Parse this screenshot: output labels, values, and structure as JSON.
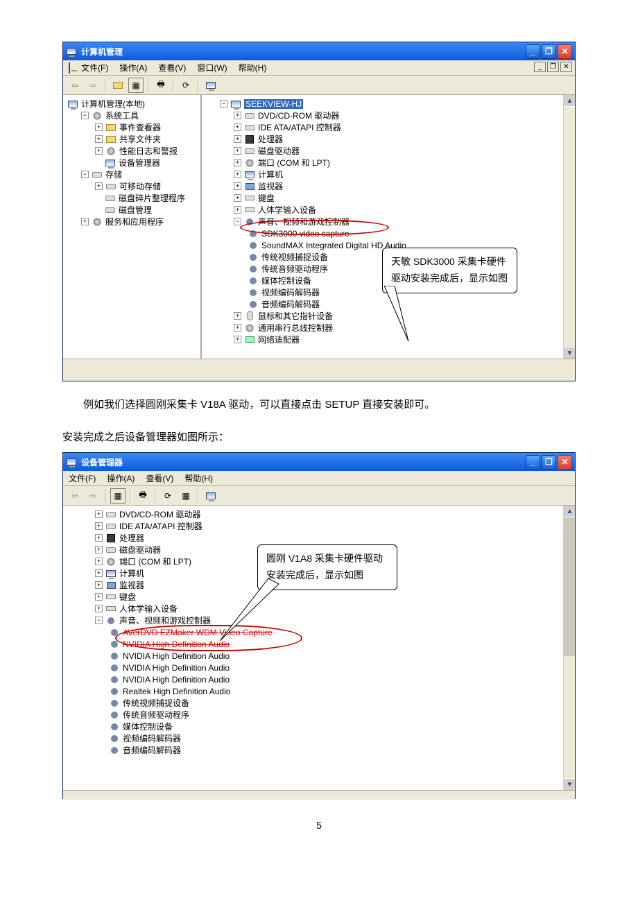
{
  "page_number": "5",
  "body_text_1": "例如我们选择圆刚采集卡 V18A 驱动，可以直接点击 SETUP 直接安装即可。",
  "body_text_2": "安装完成之后设备管理器如图所示：",
  "win1": {
    "title": "计算机管理",
    "menu": {
      "file": "文件(F)",
      "action": "操作(A)",
      "view": "查看(V)",
      "window": "窗口(W)",
      "help": "帮助(H)"
    },
    "left_tree": {
      "root": "计算机管理(本地)",
      "sys_tools": "系统工具",
      "event_viewer": "事件查看器",
      "shared_folders": "共享文件夹",
      "perf": "性能日志和警报",
      "dev_mgr": "设备管理器",
      "storage": "存储",
      "removable": "可移动存储",
      "defrag": "磁盘碎片整理程序",
      "disk_mgmt": "磁盘管理",
      "services": "服务和应用程序"
    },
    "right_tree": {
      "root": "SEEKVIEW-HJ",
      "dvd": "DVD/CD-ROM 驱动器",
      "ide": "IDE ATA/ATAPI 控制器",
      "cpu": "处理器",
      "disk_drive": "磁盘驱动器",
      "ports": "端口 (COM 和 LPT)",
      "computer": "计算机",
      "monitor": "监视器",
      "keyboard": "键盘",
      "hid": "人体学输入设备",
      "sound": "声音、视频和游戏控制器",
      "sdk3000": "SDK3000 video capture",
      "soundmax": "SoundMAX Integrated Digital HD Audio",
      "legacy_vid": "传统视频捕捉设备",
      "legacy_aud": "传统音频驱动程序",
      "media_ctrl": "媒体控制设备",
      "vid_codec": "视频编码解码器",
      "aud_codec": "音频编码解码器",
      "mouse": "鼠标和其它指针设备",
      "usb": "通用串行总线控制器",
      "network": "网络适配器"
    },
    "callout": "天敏 SDK3000 采集卡硬件驱动安装完成后，显示如图"
  },
  "win2": {
    "title": "设备管理器",
    "menu": {
      "file": "文件(F)",
      "action": "操作(A)",
      "view": "查看(V)",
      "help": "帮助(H)"
    },
    "tree": {
      "dvd": "DVD/CD-ROM 驱动器",
      "ide": "IDE ATA/ATAPI 控制器",
      "cpu": "处理器",
      "disk_drive": "磁盘驱动器",
      "ports": "端口 (COM 和 LPT)",
      "computer": "计算机",
      "monitor": "监视器",
      "keyboard": "键盘",
      "hid": "人体学输入设备",
      "sound": "声音、视频和游戏控制器",
      "averdvd": "AVerDVD EZMaker WDM Video Capture",
      "nvidia_hd1": "NVIDIA High Definition Audio",
      "nvidia_hd2": "NVIDIA High Definition Audio",
      "nvidia_hd3": "NVIDIA High Definition Audio",
      "nvidia_hd4": "NVIDIA High Definition Audio",
      "realtek": "Realtek High Definition Audio",
      "legacy_vid": "传统视频捕捉设备",
      "legacy_aud": "传统音频驱动程序",
      "media_ctrl": "媒体控制设备",
      "vid_codec": "视频编码解码器",
      "aud_codec": "音频编码解码器"
    },
    "callout": "圆刚 V1A8 采集卡硬件驱动安装完成后，显示如图"
  }
}
